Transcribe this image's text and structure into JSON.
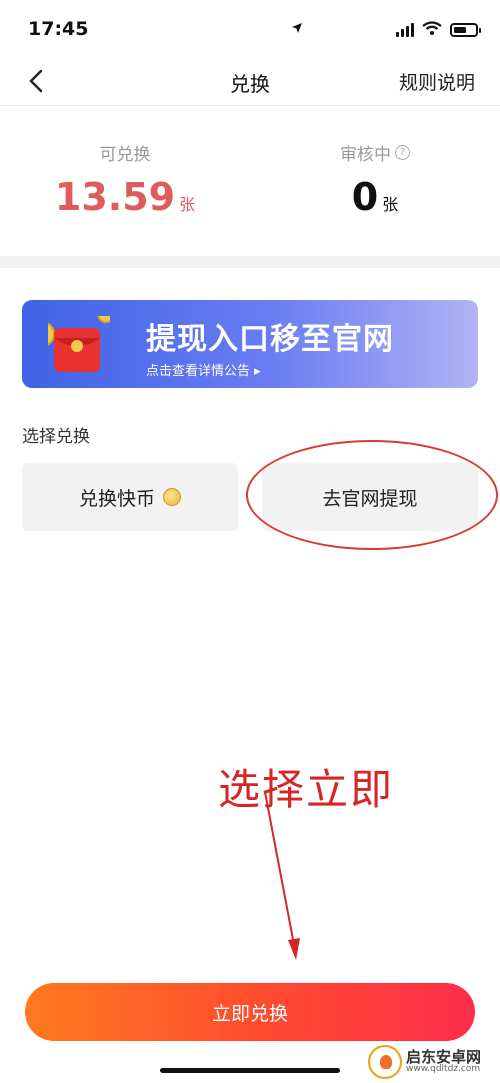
{
  "status_bar": {
    "time": "17:45"
  },
  "nav": {
    "title": "兑换",
    "rules": "规则说明"
  },
  "stats": {
    "available": {
      "label": "可兑换",
      "value": "13.59",
      "unit": "张"
    },
    "reviewing": {
      "label": "审核中",
      "value": "0",
      "unit": "张"
    }
  },
  "banner": {
    "title": "提现入口移至官网",
    "subtitle": "点击查看详情公告 ▸"
  },
  "section": {
    "title": "选择兑换"
  },
  "options": [
    {
      "label": "兑换快币"
    },
    {
      "label": "去官网提现"
    }
  ],
  "annotation": {
    "text": "选择立即"
  },
  "cta": {
    "label": "立即兑换"
  },
  "watermark": {
    "name": "启东安卓网",
    "url": "www.qdltdz.com"
  },
  "colors": {
    "accent_red": "#e05b5b",
    "banner_blue": "#3f63e6",
    "cta_start": "#ff7a1f",
    "cta_end": "#ff2d4b",
    "annotation_red": "#d62525"
  }
}
